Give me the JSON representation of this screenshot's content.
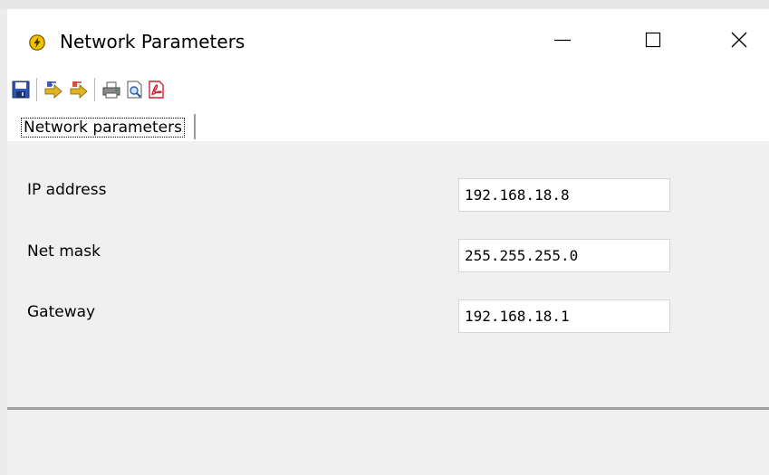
{
  "window": {
    "title": "Network Parameters",
    "controls": {
      "minimize": "minimize-icon",
      "maximize": "maximize-icon",
      "close": "close-icon"
    }
  },
  "toolbar": {
    "icons": [
      "save-icon",
      "import-icon",
      "export-icon",
      "print-icon",
      "print-preview-icon",
      "pdf-export-icon"
    ]
  },
  "tabs": [
    {
      "label": "Network parameters",
      "active": true
    }
  ],
  "form": {
    "ip_address": {
      "label": "IP address",
      "value": "192.168.18.8"
    },
    "net_mask": {
      "label": "Net mask",
      "value": "255.255.255.0"
    },
    "gateway": {
      "label": "Gateway",
      "value": "192.168.18.1"
    }
  },
  "colors": {
    "window_bg": "#f0f0f0",
    "titlebar_bg": "#ffffff",
    "app_icon": "#f2c200",
    "pdf_icon": "#d8202a"
  }
}
